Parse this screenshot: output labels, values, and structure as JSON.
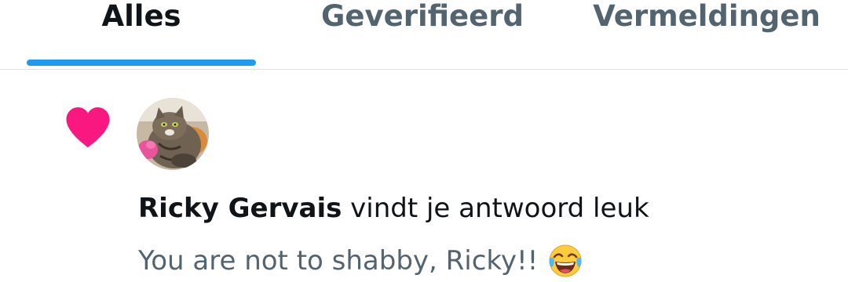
{
  "tabs": [
    {
      "label": "Alles",
      "active": true
    },
    {
      "label": "Geverifieerd",
      "active": false
    },
    {
      "label": "Vermeldingen",
      "active": false
    }
  ],
  "notification": {
    "type_icon": "heart-icon",
    "user_name": "Ricky Gervais",
    "action_text": " vindt je antwoord leuk",
    "reply_text": "You are not to shabby, Ricky!!",
    "reply_emoji": "tears-of-joy-emoji"
  },
  "colors": {
    "accent": "#1d9bf0",
    "heart": "#f91880",
    "text_primary": "#0f1419",
    "text_secondary": "#536471",
    "divider": "#dfe3e6"
  }
}
